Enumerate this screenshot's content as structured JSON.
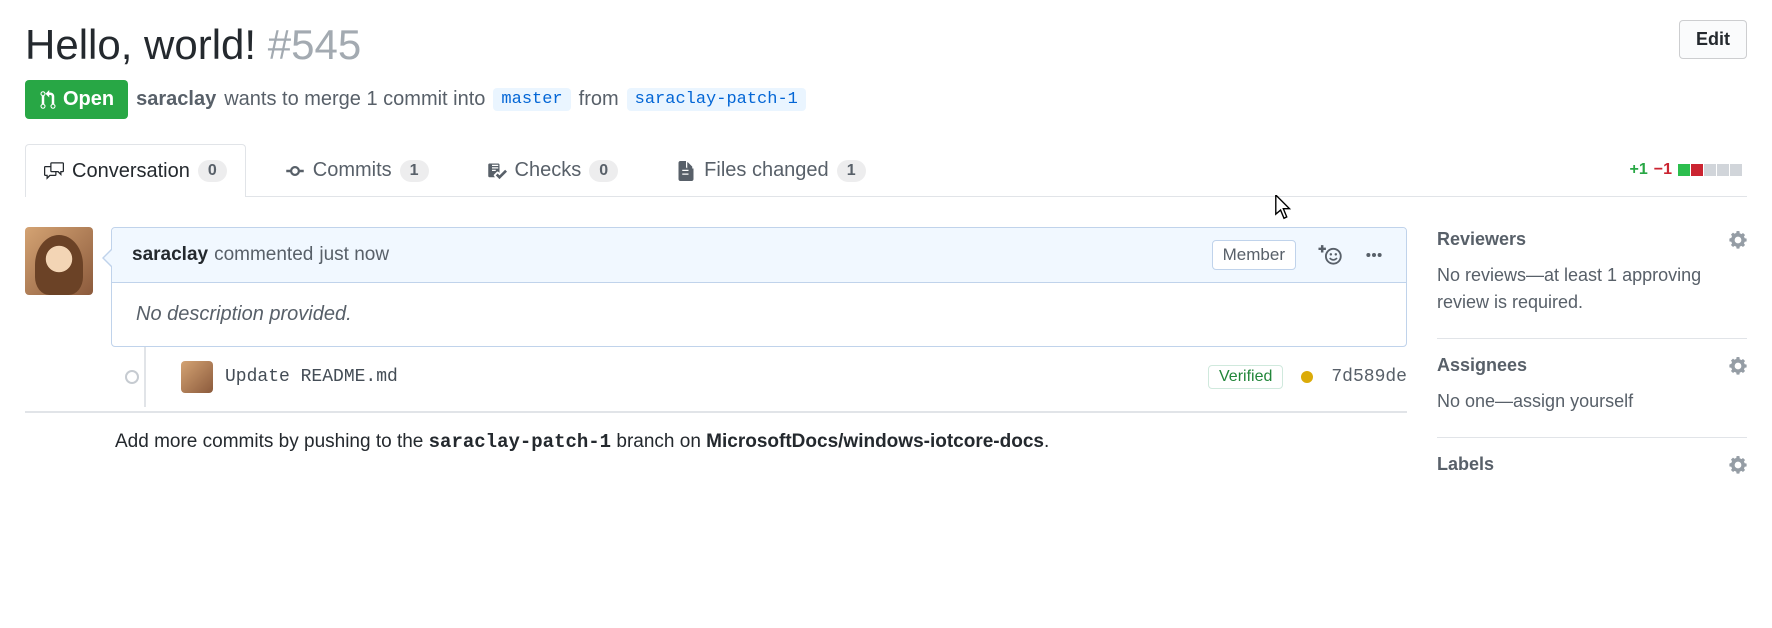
{
  "header": {
    "title": "Hello, world!",
    "issue_number": "#545",
    "edit_label": "Edit"
  },
  "meta": {
    "state_label": "Open",
    "author": "saraclay",
    "wants_text": "wants to merge 1 commit into",
    "base_branch": "master",
    "from_text": "from",
    "head_branch": "saraclay-patch-1"
  },
  "tabs": {
    "conversation": {
      "label": "Conversation",
      "count": "0"
    },
    "commits": {
      "label": "Commits",
      "count": "1"
    },
    "checks": {
      "label": "Checks",
      "count": "0"
    },
    "files": {
      "label": "Files changed",
      "count": "1"
    }
  },
  "diffstat": {
    "additions": "+1",
    "deletions": "−1",
    "blocks": [
      "add",
      "del",
      "neutral",
      "neutral",
      "neutral"
    ]
  },
  "comment": {
    "author": "saraclay",
    "action": "commented",
    "time": "just now",
    "role": "Member",
    "body": "No description provided."
  },
  "commit": {
    "message": "Update README.md",
    "verified_label": "Verified",
    "status": "pending",
    "hash": "7d589de"
  },
  "push_hint": {
    "prefix": "Add more commits by pushing to the ",
    "branch": "saraclay-patch-1",
    "mid": " branch on ",
    "repo": "MicrosoftDocs/windows-iotcore-docs",
    "suffix": "."
  },
  "sidebar": {
    "reviewers": {
      "title": "Reviewers",
      "text": "No reviews—at least 1 approving review is required."
    },
    "assignees": {
      "title": "Assignees",
      "none_text": "No one—",
      "assign_self": "assign yourself"
    },
    "labels": {
      "title": "Labels"
    }
  }
}
